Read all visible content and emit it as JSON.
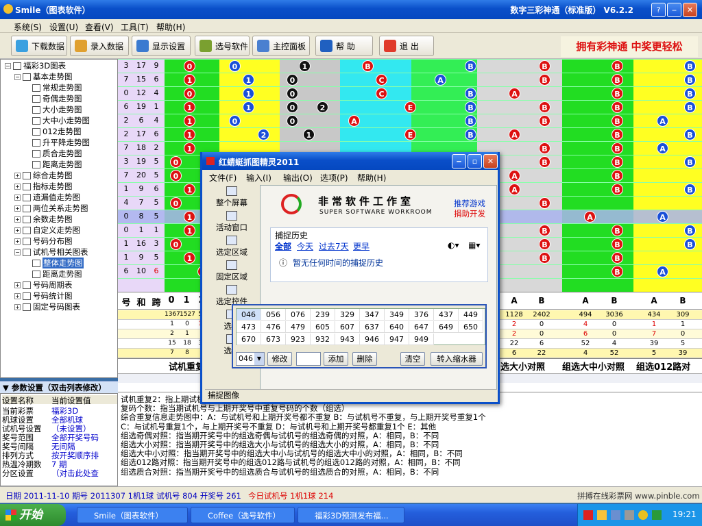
{
  "window": {
    "title": "Smile（图表软件）",
    "version": "数字三彩神通（标准版） V6.2.2",
    "min": "‒",
    "max": "▫",
    "close": "✕"
  },
  "menubar": [
    "系统(S)",
    "设置(U)",
    "查看(V)",
    "工具(T)",
    "帮助(H)"
  ],
  "toolbar": {
    "buttons": [
      {
        "label": "下载数据",
        "color": "#3aa0e0"
      },
      {
        "label": "录入数据",
        "color": "#e0a030"
      },
      {
        "label": "显示设置",
        "color": "#3a7ad0"
      },
      {
        "label": "选号软件",
        "color": "#7aa030"
      },
      {
        "label": "主控面板",
        "color": "#4a80d0"
      },
      {
        "label": "帮  助",
        "color": "#2060c0"
      },
      {
        "label": "退  出",
        "color": "#e03a2a"
      }
    ],
    "banner": "拥有彩神通  中奖更轻松"
  },
  "tree": [
    {
      "label": "福彩3D图表",
      "level": 0,
      "exp": "−",
      "sel": false
    },
    {
      "label": "基本走势图",
      "level": 1,
      "exp": "−",
      "sel": false
    },
    {
      "label": "常规走势图",
      "level": 2,
      "exp": "",
      "sel": false
    },
    {
      "label": "奇偶走势图",
      "level": 2,
      "exp": "",
      "sel": false
    },
    {
      "label": "大小走势图",
      "level": 2,
      "exp": "",
      "sel": false
    },
    {
      "label": "大中小走势图",
      "level": 2,
      "exp": "",
      "sel": false
    },
    {
      "label": "012走势图",
      "level": 2,
      "exp": "",
      "sel": false
    },
    {
      "label": "升平降走势图",
      "level": 2,
      "exp": "",
      "sel": false
    },
    {
      "label": "质合走势图",
      "level": 2,
      "exp": "",
      "sel": false
    },
    {
      "label": "距离走势图",
      "level": 2,
      "exp": "",
      "sel": false
    },
    {
      "label": "综合走势图",
      "level": 1,
      "exp": "+",
      "sel": false
    },
    {
      "label": "指标走势图",
      "level": 1,
      "exp": "+",
      "sel": false
    },
    {
      "label": "遗漏值走势图",
      "level": 1,
      "exp": "+",
      "sel": false
    },
    {
      "label": "两位关系走势图",
      "level": 1,
      "exp": "+",
      "sel": false
    },
    {
      "label": "余数走势图",
      "level": 1,
      "exp": "+",
      "sel": false
    },
    {
      "label": "自定义走势图",
      "level": 1,
      "exp": "+",
      "sel": false
    },
    {
      "label": "号码分布图",
      "level": 1,
      "exp": "+",
      "sel": false
    },
    {
      "label": "试机号相关图表",
      "level": 1,
      "exp": "−",
      "sel": false
    },
    {
      "label": "整体走势图",
      "level": 2,
      "exp": "",
      "sel": true
    },
    {
      "label": "距离走势图",
      "level": 2,
      "exp": "",
      "sel": false
    },
    {
      "label": "号码周期表",
      "level": 1,
      "exp": "+",
      "sel": false
    },
    {
      "label": "号码统计图",
      "level": 1,
      "exp": "+",
      "sel": false
    },
    {
      "label": "固定号码图表",
      "level": 1,
      "exp": "+",
      "sel": false
    }
  ],
  "params": {
    "header": "参数设置（双击列表修改）",
    "col1": "设置名称",
    "col2": "当前设置值",
    "rows": [
      {
        "k": "当前彩票",
        "v": "福彩3D"
      },
      {
        "k": "机球设置",
        "v": "全部机球"
      },
      {
        "k": "试机号设置",
        "v": "（未设置）"
      },
      {
        "k": "奖号范围",
        "v": "全部开奖号码"
      },
      {
        "k": "奖号间隔",
        "v": "无间隔"
      },
      {
        "k": "排列方式",
        "v": "按开奖顺序排"
      },
      {
        "k": "热温冷期数",
        "v": "7 期"
      },
      {
        "k": "分区设置",
        "v": "（对击此处查"
      }
    ]
  },
  "chart": {
    "left_rows": [
      [
        "3",
        "17",
        "9"
      ],
      [
        "7",
        "15",
        "6"
      ],
      [
        "0",
        "12",
        "4"
      ],
      [
        "6",
        "19",
        "1"
      ],
      [
        "2",
        "6",
        "4"
      ],
      [
        "2",
        "17",
        "6"
      ],
      [
        "7",
        "18",
        "2"
      ],
      [
        "3",
        "19",
        "5"
      ],
      [
        "7",
        "20",
        "5"
      ],
      [
        "1",
        "9",
        "6"
      ],
      [
        "4",
        "7",
        "5"
      ],
      [
        "0",
        "8",
        "5"
      ],
      [
        "0",
        "1",
        "1"
      ],
      [
        "1",
        "16",
        "3"
      ],
      [
        "1",
        "9",
        "5"
      ],
      [
        "6",
        "10",
        "6"
      ]
    ],
    "header_cols": [
      "号",
      "和",
      "跨",
      "0",
      "1",
      "2"
    ],
    "stat_rows": [
      [
        "1367",
        "1527",
        "55"
      ],
      [
        "1",
        "0",
        "17"
      ],
      [
        "2",
        "1",
        "5"
      ],
      [
        "15",
        "18",
        "30"
      ],
      [
        "7",
        "8",
        "3"
      ]
    ],
    "footer_left": "试机重复",
    "right_headers": [
      "A",
      "B",
      "A",
      "B",
      "A",
      "B"
    ],
    "right_stats": [
      [
        "1128",
        "2402",
        "494",
        "3036",
        "434",
        "309"
      ],
      [
        "2",
        "0",
        "4",
        "0",
        "1",
        "1"
      ],
      [
        "2",
        "0",
        "6",
        "0",
        "7",
        "0"
      ],
      [
        "22",
        "6",
        "52",
        "4",
        "39",
        "5"
      ],
      [
        "6",
        "22",
        "4",
        "52",
        "5",
        "39"
      ]
    ],
    "footer_labels": [
      "选大小对照",
      "组选大中小对照",
      "组选012路对"
    ],
    "mid_header": "A",
    "mid_header_b": "B"
  },
  "info": [
    "试机重复2：指上期试机号与上期开奖号重复号码的个数（组选）                                                    重复数字的个数（组选）",
    "复码个数：指当期试机号与上期开奖号中重复号码的个数（组选）",
    "综合重复信息走势图中：A：与试机号和上期开奖号都不重复                   B：与试机号不重复，与上期开奖号重复1个",
    "                      C：与试机号重复1个，与上期开奖号不重复           D：与试机号和上期开奖号都重复1个              E：其他",
    "组选奇偶对照：指当期开奖号中的组选奇偶与试机号的组选奇偶的对照，A：相同，B：不同",
    "组选大小对照：指当期开奖号中的组选大小与试机号的组选大小的对照，A：相同，B：不同",
    "组选大中小对照：指当期开奖号中的组选大中小与试机号的组选大中小的对照，A：相同，B：不同",
    "组选012路对照：指当期开奖号中的组选012路与试机号的组选012路的对照，A：相同，B：不同",
    "组选质合对照：指当期开奖号中的组选质合与试机号的组选质合的对照，A：相同，B：不同"
  ],
  "status": {
    "left": "日期 2011-11-10 期号 2011307 1机1球 试机号 804 开奖号 261",
    "mid": "今日试机号 1机1球 214",
    "right": "拼搏在线彩票网 www.pinble.com"
  },
  "taskbar": {
    "start": "开始",
    "tasks": [
      "Smile（图表软件）",
      "Coffee（选号软件）",
      "福彩3D预测发布福..."
    ],
    "clock": "19:21"
  },
  "popup": {
    "title": "红蜻蜓抓图精灵2011",
    "menu": [
      "文件(F)",
      "输入(I)",
      "输出(O)",
      "选项(P)",
      "帮助(H)"
    ],
    "side": [
      "整个屏幕",
      "活动窗口",
      "选定区域",
      "固定区域",
      "选定控件",
      "选定",
      "选定"
    ],
    "logo_cn": "非常软件工作室",
    "logo_en": "SUPER SOFTWARE WORKROOM",
    "links": [
      "推荐游戏",
      "捐助开发"
    ],
    "history_title": "捕捉历史",
    "history_tabs": [
      "全部",
      "今天",
      "过去7天",
      "更早"
    ],
    "history_empty": "暂无任何时间的捕捉历史",
    "status": "捕捉图像"
  },
  "numpanel": {
    "numbers": [
      "046",
      "056",
      "076",
      "239",
      "329",
      "347",
      "349",
      "376",
      "437",
      "449",
      "473",
      "476",
      "479",
      "605",
      "607",
      "637",
      "640",
      "647",
      "649",
      "650",
      "670",
      "673",
      "923",
      "932",
      "943",
      "946",
      "947",
      "949"
    ],
    "combo_value": "046",
    "buttons": [
      "修改",
      "添加",
      "删除",
      "清空",
      "转入缩水器"
    ]
  }
}
